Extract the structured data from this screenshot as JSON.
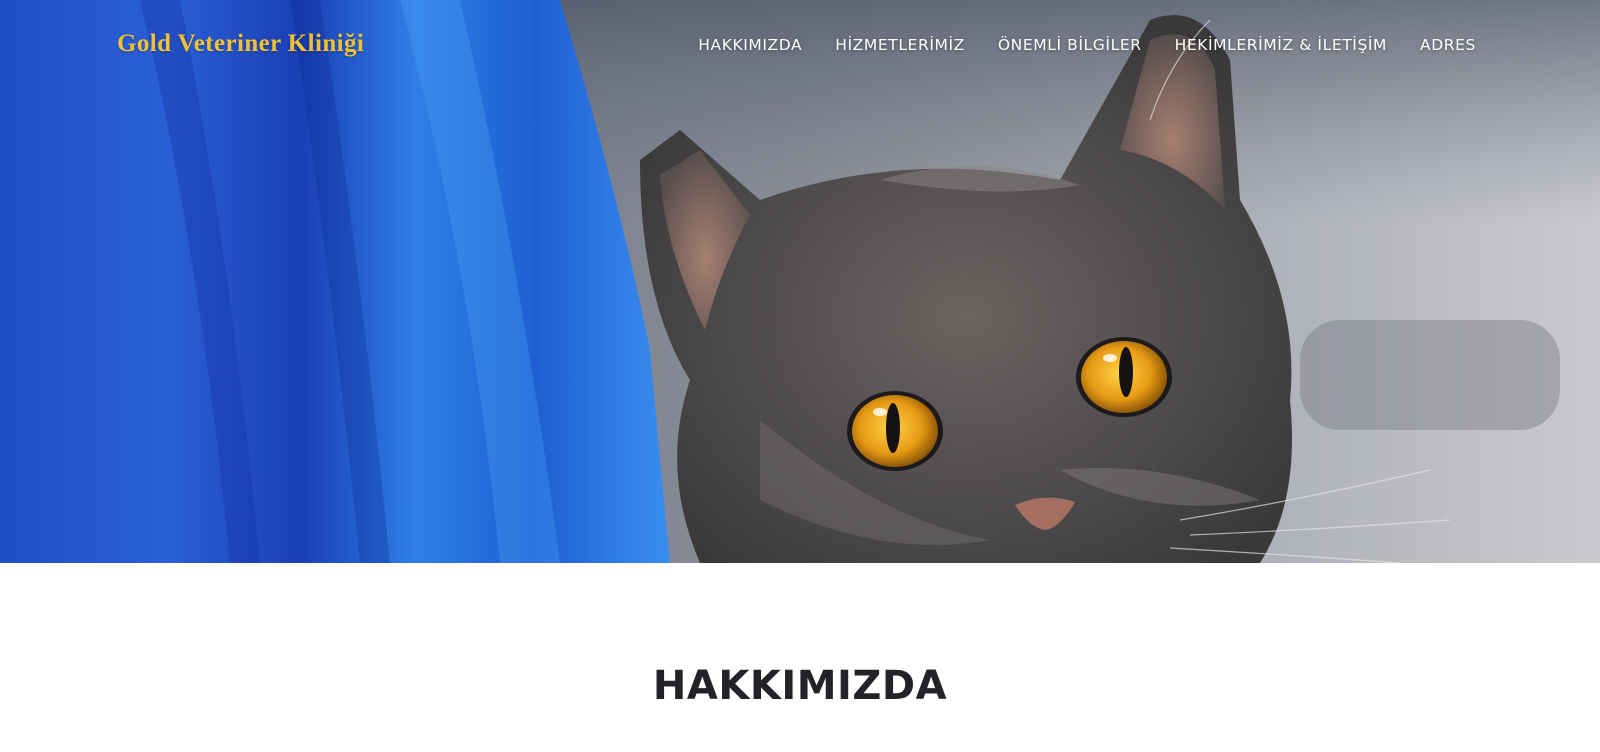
{
  "brand": {
    "name": "Gold Veteriner Kliniği",
    "color": "#f2c230"
  },
  "nav": {
    "items": [
      {
        "label": "HAKKIMIZDA"
      },
      {
        "label": "HİZMETLERİMİZ"
      },
      {
        "label": "ÖNEMLİ BİLGİLER"
      },
      {
        "label": "HEKİMLERİMİZ & İLETİŞİM"
      },
      {
        "label": "ADRES"
      }
    ]
  },
  "hero": {
    "image": "gray-cat-with-orange-eyes-behind-blue-fabric"
  },
  "about": {
    "title": "HAKKIMIZDA"
  }
}
